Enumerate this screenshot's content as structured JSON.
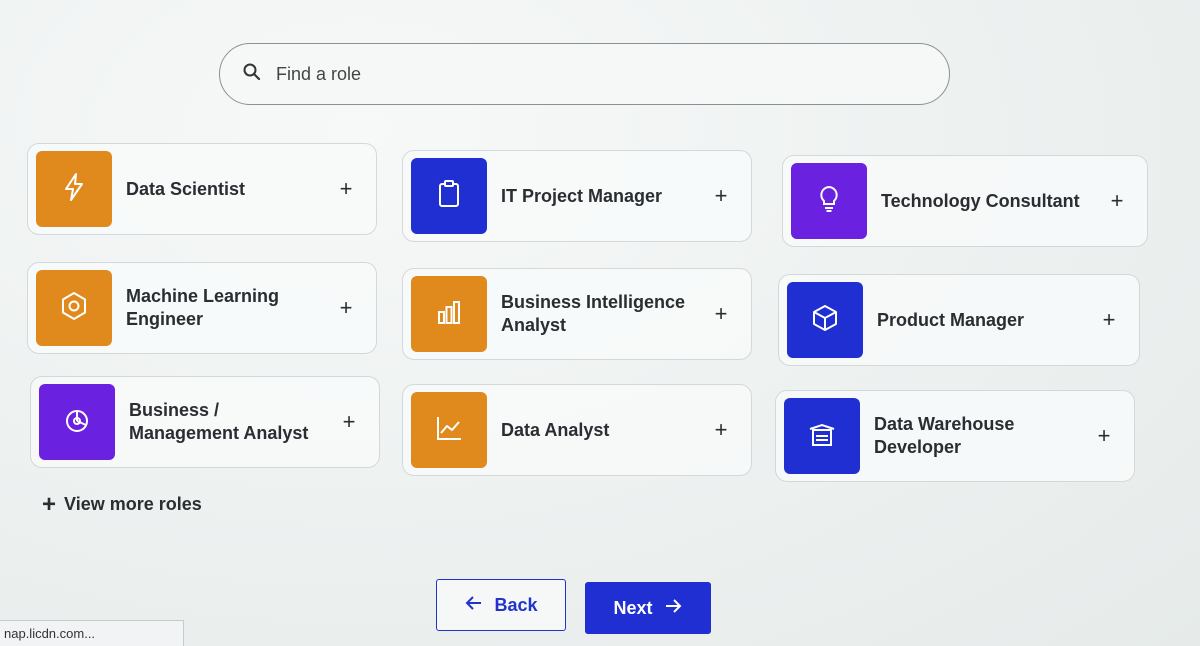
{
  "search": {
    "placeholder": "Find a role"
  },
  "roles": [
    {
      "label": "Data Scientist",
      "icon": "lightning-icon",
      "color": "#e08a1e"
    },
    {
      "label": "IT Project Manager",
      "icon": "clipboard-icon",
      "color": "#1f2fd1"
    },
    {
      "label": "Technology Consultant",
      "icon": "lightbulb-icon",
      "color": "#6a22e0"
    },
    {
      "label": "Machine Learning Engineer",
      "icon": "hexagon-icon",
      "color": "#e08a1e"
    },
    {
      "label": "Business Intelligence Analyst",
      "icon": "bar-chart-icon",
      "color": "#e08a1e"
    },
    {
      "label": "Product Manager",
      "icon": "cube-icon",
      "color": "#1f2fd1"
    },
    {
      "label": "Business / Management Analyst",
      "icon": "pie-chart-icon",
      "color": "#6a22e0"
    },
    {
      "label": "Data Analyst",
      "icon": "line-chart-icon",
      "color": "#e08a1e"
    },
    {
      "label": "Data Warehouse Developer",
      "icon": "warehouse-icon",
      "color": "#1f2fd1"
    }
  ],
  "add_symbol": "+",
  "view_more": {
    "symbol": "+",
    "label": "View more roles"
  },
  "buttons": {
    "back": "Back",
    "next": "Next"
  },
  "status_bar": {
    "url": "nap.licdn.com..."
  }
}
